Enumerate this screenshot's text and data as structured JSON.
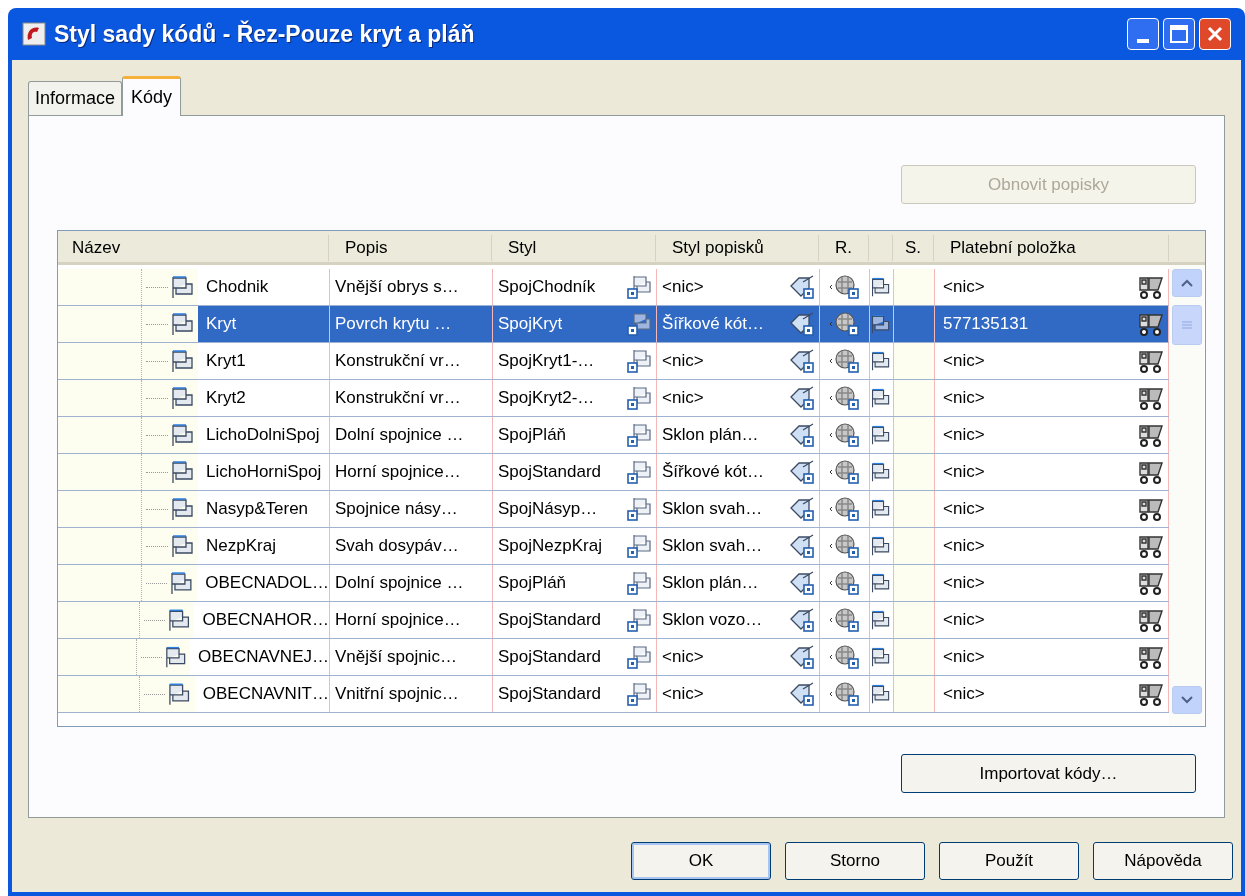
{
  "window": {
    "title": "Styl sady kódů - Řez-Pouze kryt a pláň"
  },
  "tabs": [
    {
      "label": "Informace",
      "selected": false
    },
    {
      "label": "Kódy",
      "selected": true
    }
  ],
  "refresh_button": {
    "label": "Obnovit popisky",
    "disabled": true
  },
  "table": {
    "columns": [
      "Název",
      "Popis",
      "Styl",
      "Styl popisků",
      "R.",
      "S.",
      "Platební položka"
    ],
    "rows": [
      {
        "name": "Chodnik",
        "description": "Vnější obrys s…",
        "style": "SpojChodník",
        "label_style": "<nic>",
        "pay_item": "<nic>",
        "selected": false
      },
      {
        "name": "Kryt",
        "description": "Povrch krytu …",
        "style": "SpojKryt",
        "label_style": "Šířkové kót…",
        "pay_item": "577135131",
        "selected": true
      },
      {
        "name": "Kryt1",
        "description": "Konstrukční vr…",
        "style": "SpojKryt1-…",
        "label_style": "<nic>",
        "pay_item": "<nic>",
        "selected": false
      },
      {
        "name": "Kryt2",
        "description": "Konstrukční vr…",
        "style": "SpojKryt2-…",
        "label_style": "<nic>",
        "pay_item": "<nic>",
        "selected": false
      },
      {
        "name": "LichoDolniSpoj",
        "description": "Dolní spojnice …",
        "style": "SpojPláň",
        "label_style": "Sklon plán…",
        "pay_item": "<nic>",
        "selected": false
      },
      {
        "name": "LichoHorniSpoj",
        "description": "Horní spojnice…",
        "style": "SpojStandard",
        "label_style": "Šířkové kót…",
        "pay_item": "<nic>",
        "selected": false
      },
      {
        "name": "Nasyp&Teren",
        "description": "Spojnice násy…",
        "style": "SpojNásyp…",
        "label_style": "Sklon svah…",
        "pay_item": "<nic>",
        "selected": false
      },
      {
        "name": "NezpKraj",
        "description": "Svah dosypáv…",
        "style": "SpojNezpKraj",
        "label_style": "Sklon svah…",
        "pay_item": "<nic>",
        "selected": false
      },
      {
        "name": "OBECNADOL…",
        "description": "Dolní spojnice …",
        "style": "SpojPláň",
        "label_style": "Sklon plán…",
        "pay_item": "<nic>",
        "selected": false
      },
      {
        "name": "OBECNAHOR…",
        "description": "Horní spojnice…",
        "style": "SpojStandard",
        "label_style": "Sklon vozo…",
        "pay_item": "<nic>",
        "selected": false
      },
      {
        "name": "OBECNAVNEJ…",
        "description": "Vnější spojnic…",
        "style": "SpojStandard",
        "label_style": "<nic>",
        "pay_item": "<nic>",
        "selected": false
      },
      {
        "name": "OBECNAVNIT…",
        "description": "Vnitřní spojnic…",
        "style": "SpojStandard",
        "label_style": "<nic>",
        "pay_item": "<nic>",
        "selected": false
      }
    ]
  },
  "import_button": "Importovat kódy…",
  "buttons": [
    "OK",
    "Storno",
    "Použít",
    "Nápověda"
  ]
}
